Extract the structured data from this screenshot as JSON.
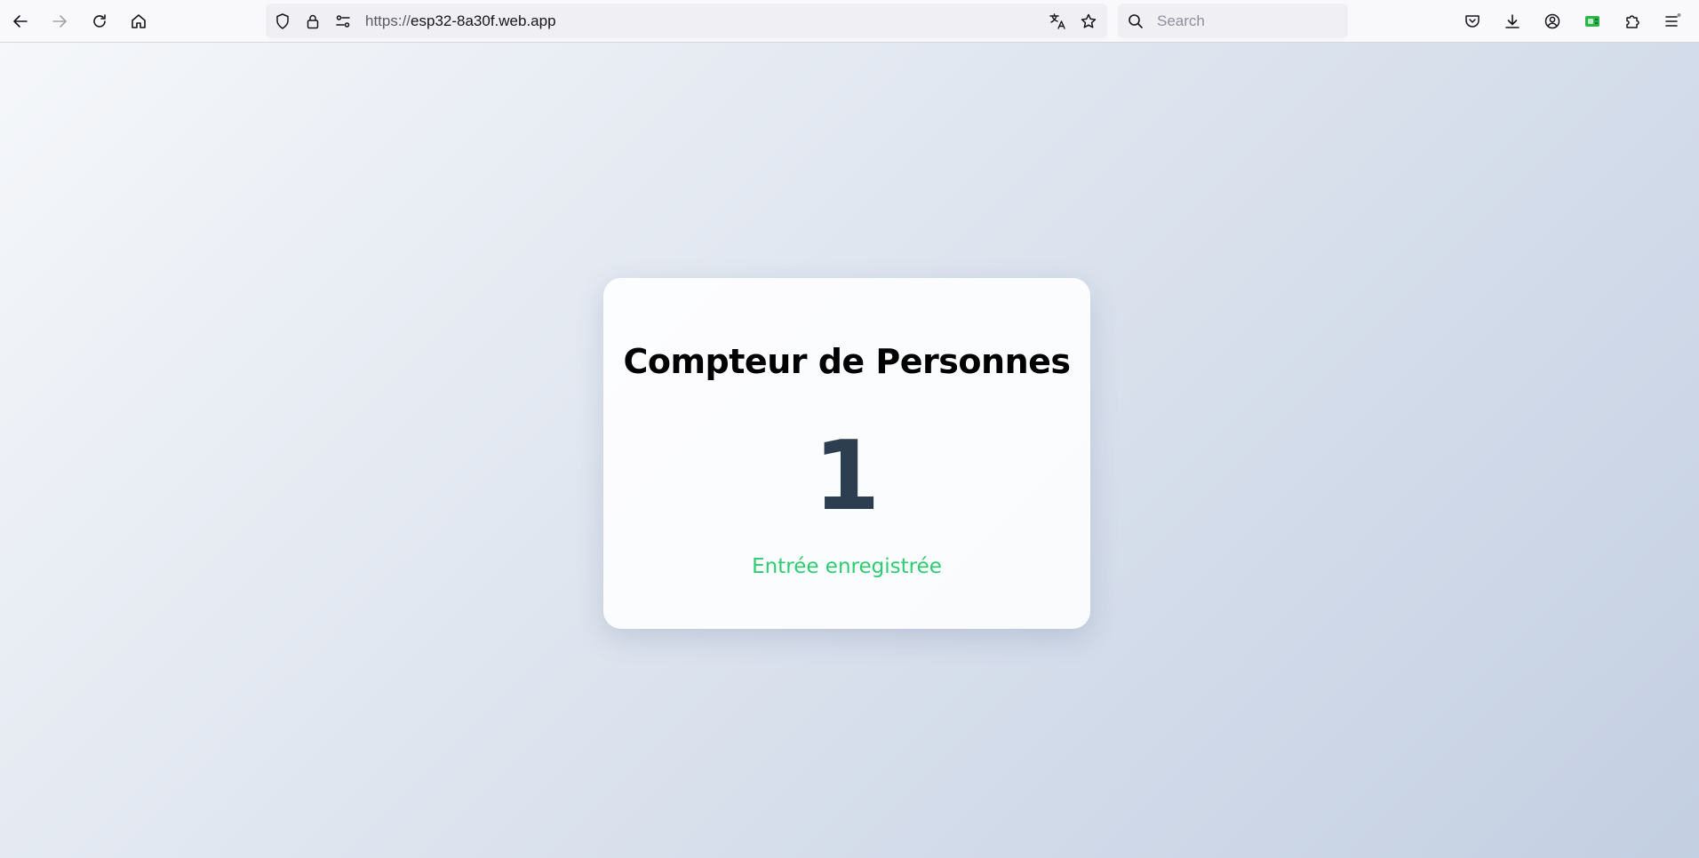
{
  "browser": {
    "url_protocol": "https://",
    "url_host": "esp32-8a30f.web.app",
    "search_placeholder": "Search",
    "icons": {
      "back": "back-arrow-icon",
      "forward": "forward-arrow-icon",
      "reload": "reload-icon",
      "home": "home-icon",
      "tracking_protection": "shield-icon",
      "lock": "lock-icon",
      "permissions": "permissions-icon",
      "translate": "translate-icon",
      "bookmark": "star-icon",
      "search": "search-icon",
      "pocket": "pocket-icon",
      "downloads": "download-icon",
      "account": "account-icon",
      "extension_green": "green-extension-icon",
      "extensions": "puzzle-icon",
      "menu": "hamburger-menu-icon"
    }
  },
  "page": {
    "title": "Compteur de Personnes",
    "count": "1",
    "status": "Entrée enregistrée"
  },
  "colors": {
    "count_color": "#2c3e50",
    "status_color": "#2ecc71",
    "bg_gradient_start": "#f5f7fa",
    "bg_gradient_end": "#c3cfe2"
  }
}
